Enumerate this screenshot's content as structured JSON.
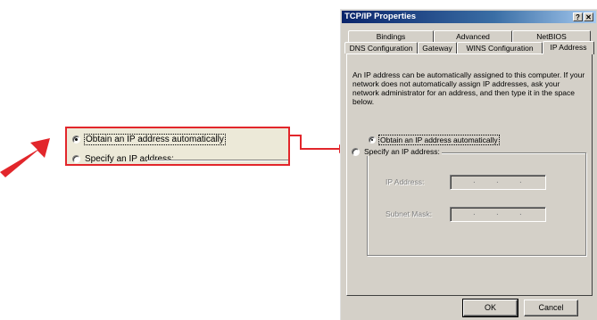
{
  "callout": {
    "option_auto": "Obtain an IP address automatically",
    "option_specify": "Specify an IP address:"
  },
  "dialog": {
    "title": "TCP/IP Properties",
    "help_glyph": "?",
    "close_glyph": "✕",
    "tabs_row1": [
      "Bindings",
      "Advanced",
      "NetBIOS"
    ],
    "tabs_row2": [
      "DNS Configuration",
      "Gateway",
      "WINS Configuration",
      "IP Address"
    ],
    "active_tab": "IP Address",
    "description": "An IP address can be automatically assigned to this computer. If your network does not automatically assign IP addresses, ask your network administrator for an address, and then type it in the space below.",
    "option_auto": "Obtain an IP address automatically",
    "option_specify": "Specify an IP address:",
    "ip_label": "IP Address:",
    "subnet_label": "Subnet Mask:",
    "ok_label": "OK",
    "cancel_label": "Cancel"
  },
  "colors": {
    "accent_red": "#e2262b",
    "titlebar_start": "#0a246a",
    "titlebar_end": "#a6caf0",
    "dialog_face": "#d4d0c8"
  }
}
